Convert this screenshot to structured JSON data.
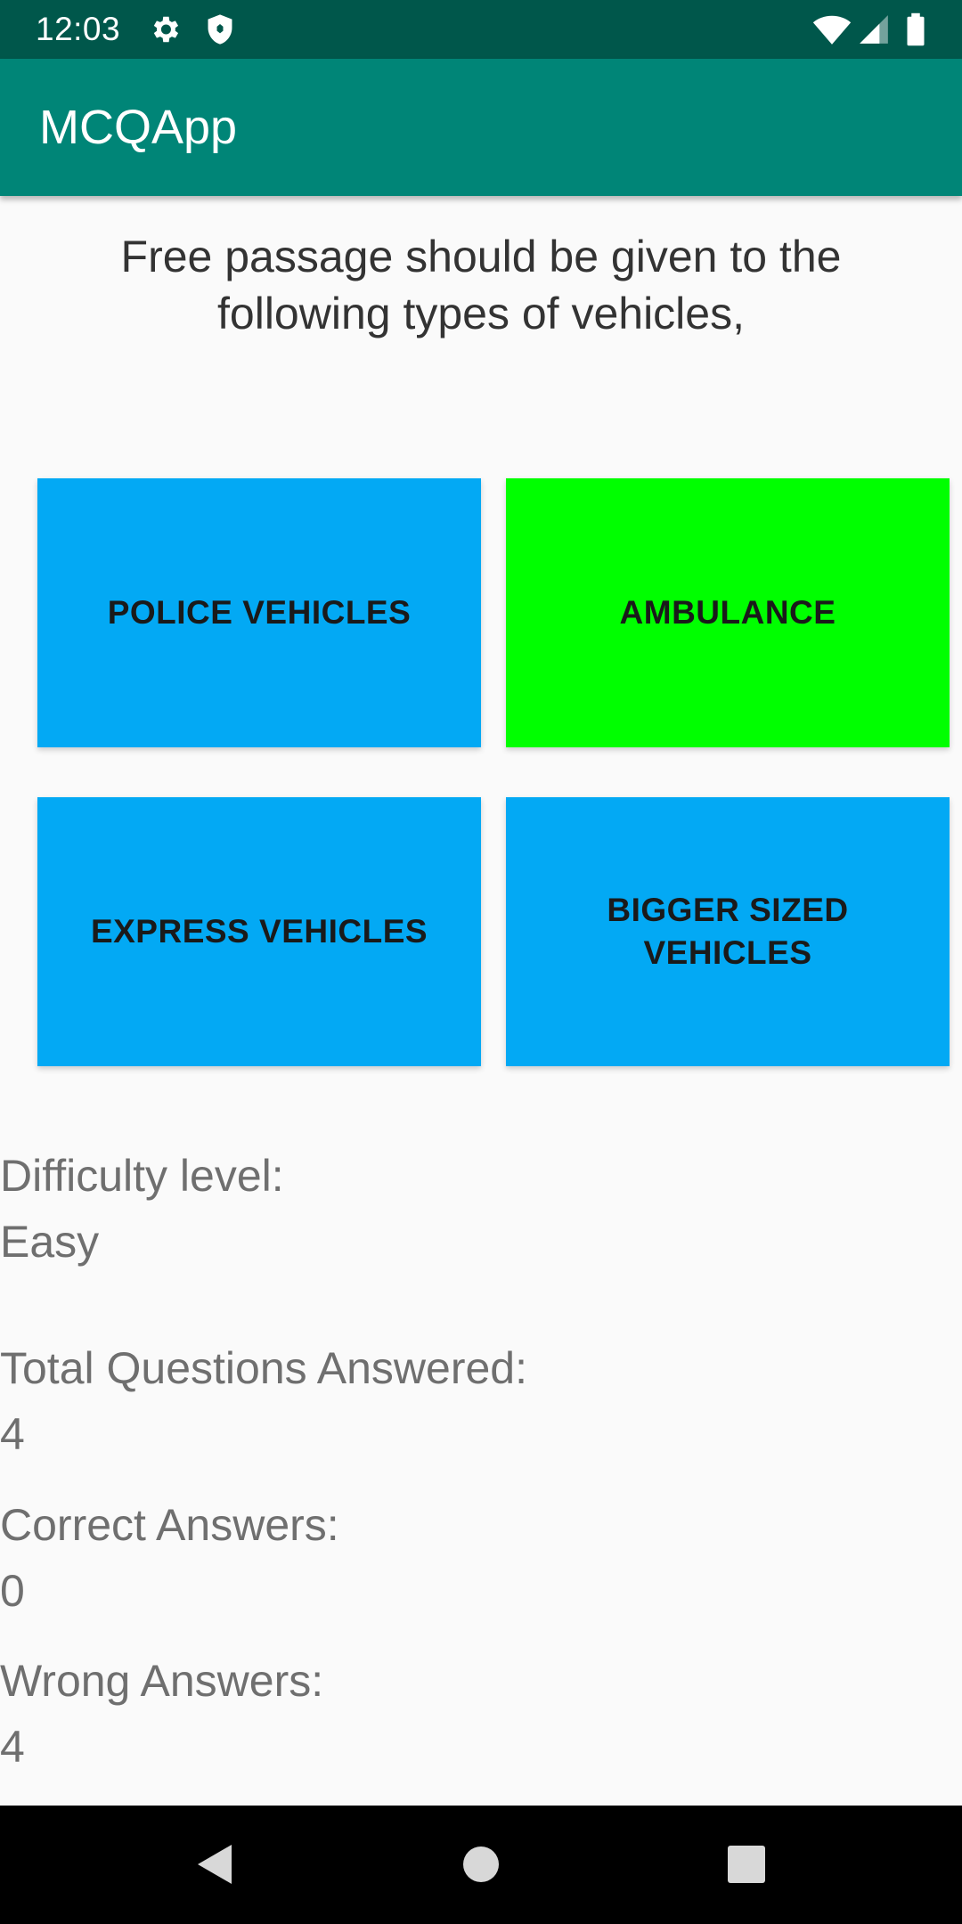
{
  "status_bar": {
    "time": "12:03",
    "icons_left": [
      "gear-icon",
      "shield-icon"
    ],
    "icons_right": [
      "wifi-icon",
      "signal-icon",
      "battery-icon"
    ]
  },
  "app_bar": {
    "title": "MCQApp"
  },
  "question": {
    "text": "Free passage should be given to the following types of vehicles,"
  },
  "answers": [
    {
      "label": "POLICE VEHICLES",
      "color": "#03a9f4"
    },
    {
      "label": "AMBULANCE",
      "color": "#00ff00"
    },
    {
      "label": "EXPRESS VEHICLES",
      "color": "#03a9f4"
    },
    {
      "label": "BIGGER SIZED VEHICLES",
      "color": "#03a9f4"
    }
  ],
  "stats": {
    "difficulty_label": "Difficulty level:",
    "difficulty_value": "Easy",
    "total_label": "Total Questions Answered:",
    "total_value": "4",
    "correct_label": "Correct Answers:",
    "correct_value": "0",
    "wrong_label": "Wrong Answers:",
    "wrong_value": "4"
  },
  "nav_bar": {
    "buttons": [
      "back-icon",
      "home-icon",
      "recents-icon"
    ]
  },
  "colors": {
    "status_bar": "#00574b",
    "app_bar": "#008577",
    "background": "#fafafa",
    "stat_text": "#6f6f6f"
  }
}
